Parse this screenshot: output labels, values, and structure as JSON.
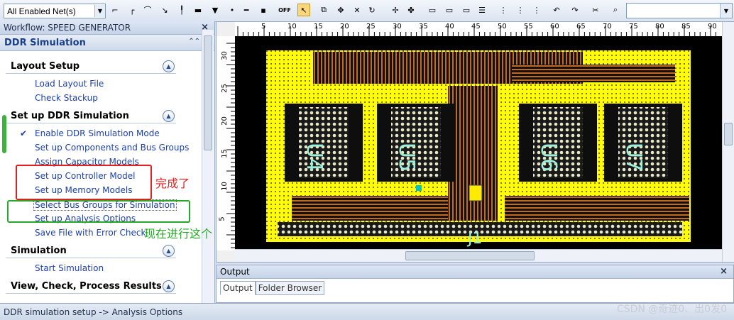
{
  "toolbar": {
    "net_filter": "All Enabled Net(s)",
    "off_label": "OFF",
    "search_value": ""
  },
  "workflow": {
    "title": "Workflow: SPEED GENERATOR",
    "close": "×",
    "header": "DDR Simulation",
    "sections": [
      {
        "title": "Layout Setup",
        "items": [
          "Load Layout File",
          "Check Stackup"
        ]
      },
      {
        "title": "Set up DDR Simulation",
        "items": [
          "Enable DDR Simulation Mode",
          "Set up Components and Bus Groups",
          "Assign Capacitor Models",
          "Set up Controller Model",
          "Set up Memory Models",
          "Select Bus Groups for Simulation",
          "Set up Analysis Options",
          "Save File with Error Check"
        ]
      },
      {
        "title": "Simulation",
        "items": [
          "Start Simulation"
        ]
      },
      {
        "title": "View, Check, Process Results",
        "items": []
      }
    ],
    "annotation_red": "完成了",
    "annotation_green": "现在进行这个"
  },
  "canvas": {
    "ruler_top": [
      "5",
      "10",
      "15",
      "20",
      "25",
      "30",
      "35",
      "40",
      "45",
      "50",
      "55",
      "60",
      "65",
      "70",
      "75",
      "80",
      "85",
      "90"
    ],
    "ruler_left": [
      "30",
      "25",
      "20",
      "15",
      "10",
      "5"
    ],
    "components": [
      "U4",
      "U5",
      "U6",
      "U7",
      "J1"
    ]
  },
  "output": {
    "title": "Output",
    "close": "×",
    "tabs": [
      "Output",
      "Folder Browser"
    ]
  },
  "status": {
    "text": "DDR simulation setup -> Analysis Options"
  },
  "watermark": "CSDN @奇迹0、出0发0",
  "colors": {
    "board": "#ffff00",
    "background": "#000000",
    "trace": "#c46a1f",
    "link": "#1c3faa",
    "red": "#e02020",
    "green": "#28a828"
  }
}
